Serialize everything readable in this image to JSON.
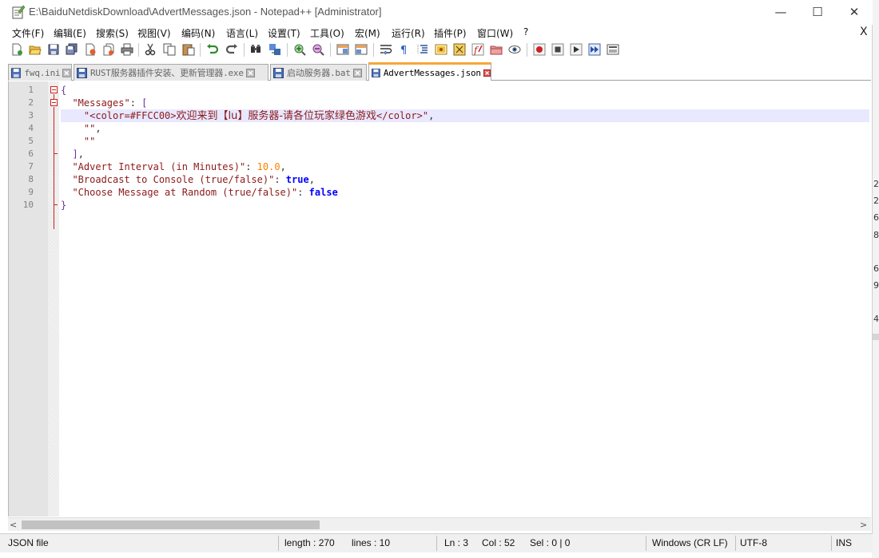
{
  "window": {
    "title": "E:\\BaiduNetdiskDownload\\AdvertMessages.json - Notepad++ [Administrator]",
    "min_glyph": "—",
    "max_glyph": "☐",
    "close_glyph": "✕"
  },
  "menu": {
    "items": [
      "文件(F)",
      "编辑(E)",
      "搜索(S)",
      "视图(V)",
      "编码(N)",
      "语言(L)",
      "设置(T)",
      "工具(O)",
      "宏(M)",
      "运行(R)",
      "插件(P)",
      "窗口(W)",
      "?"
    ],
    "close_doc": "X"
  },
  "toolbar": {
    "icons": [
      "new-file-icon",
      "open-file-icon",
      "save-icon",
      "save-all-icon",
      "close-icon",
      "close-all-icon",
      "print-icon",
      "cut-icon",
      "copy-icon",
      "paste-icon",
      "undo-icon",
      "redo-icon",
      "find-icon",
      "replace-icon",
      "zoom-in-icon",
      "zoom-out-icon",
      "sync-vertical-icon",
      "sync-horizontal-icon",
      "word-wrap-icon",
      "show-all-chars-icon",
      "indent-guide-icon",
      "user-lang-icon",
      "doc-map-icon",
      "function-list-icon",
      "folder-workspace-icon",
      "monitoring-icon",
      "record-macro-icon",
      "stop-record-icon",
      "play-macro-icon",
      "run-macro-multiple-icon",
      "save-macro-icon"
    ]
  },
  "tabs": [
    {
      "label": "fwq.ini",
      "active": false
    },
    {
      "label": "RUST服务器插件安装、更新管理器.exe",
      "active": false
    },
    {
      "label": "启动服务器.bat",
      "active": false
    },
    {
      "label": "AdvertMessages.json",
      "active": true
    }
  ],
  "editor": {
    "current_line": 3,
    "line_numbers": [
      "1",
      "2",
      "3",
      "4",
      "5",
      "6",
      "7",
      "8",
      "9",
      "10"
    ],
    "lines": [
      [
        {
          "t": "{",
          "c": "brace"
        }
      ],
      [
        {
          "t": "  ",
          "c": "punct"
        },
        {
          "t": "\"Messages\"",
          "c": "key"
        },
        {
          "t": ": ",
          "c": "punct"
        },
        {
          "t": "[",
          "c": "brace"
        }
      ],
      [
        {
          "t": "    ",
          "c": "punct"
        },
        {
          "t": "\"<color=#FFCC00>",
          "c": "str"
        },
        {
          "t": "欢迎来到【lu】服务器-请各位玩家绿色游戏",
          "c": "cjk"
        },
        {
          "t": "</color>\"",
          "c": "str"
        },
        {
          "t": ",",
          "c": "punct"
        }
      ],
      [
        {
          "t": "    ",
          "c": "punct"
        },
        {
          "t": "\"\"",
          "c": "str"
        },
        {
          "t": ",",
          "c": "punct"
        }
      ],
      [
        {
          "t": "    ",
          "c": "punct"
        },
        {
          "t": "\"\"",
          "c": "str"
        }
      ],
      [
        {
          "t": "  ",
          "c": "punct"
        },
        {
          "t": "]",
          "c": "brace"
        },
        {
          "t": ",",
          "c": "punct"
        }
      ],
      [
        {
          "t": "  ",
          "c": "punct"
        },
        {
          "t": "\"Advert Interval (in Minutes)\"",
          "c": "key"
        },
        {
          "t": ": ",
          "c": "punct"
        },
        {
          "t": "10.0",
          "c": "num"
        },
        {
          "t": ",",
          "c": "punct"
        }
      ],
      [
        {
          "t": "  ",
          "c": "punct"
        },
        {
          "t": "\"Broadcast to Console (true/false)\"",
          "c": "key"
        },
        {
          "t": ": ",
          "c": "punct"
        },
        {
          "t": "true",
          "c": "bool"
        },
        {
          "t": ",",
          "c": "punct"
        }
      ],
      [
        {
          "t": "  ",
          "c": "punct"
        },
        {
          "t": "\"Choose Message at Random (true/false)\"",
          "c": "key"
        },
        {
          "t": ": ",
          "c": "punct"
        },
        {
          "t": "false",
          "c": "bool"
        }
      ],
      [
        {
          "t": "}",
          "c": "brace"
        }
      ]
    ]
  },
  "scrollbar": {
    "left_arrow": "<",
    "right_arrow": ">"
  },
  "status": {
    "file_type": "JSON file",
    "length": "length : 270",
    "lines": "lines : 10",
    "ln": "Ln : 3",
    "col": "Col : 52",
    "sel": "Sel : 0 | 0",
    "eol": "Windows (CR LF)",
    "encoding": "UTF-8",
    "mode": "INS"
  },
  "background_window": {
    "fragments": [
      "2",
      "2",
      "6",
      "8",
      "6",
      "9",
      "4"
    ]
  },
  "colors": {
    "accent_tab": "#f7a73a",
    "string": "#8b1a1a",
    "number": "#ff8000",
    "keyword": "#0000ff",
    "brace": "#7030a0",
    "current_line": "#e8e8ff"
  }
}
